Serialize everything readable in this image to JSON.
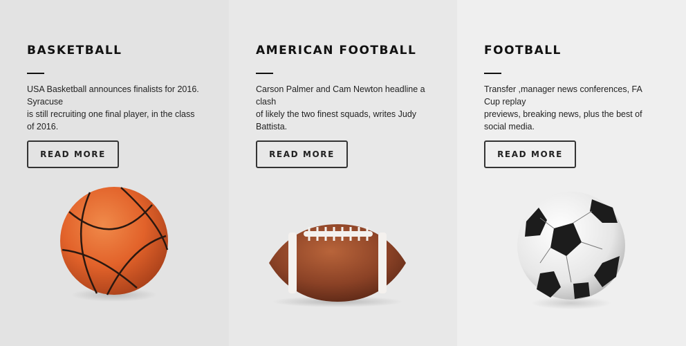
{
  "cards": [
    {
      "title": "BASKETBALL",
      "desc_lines": [
        "USA Basketball announces finalists for 2016. Syracuse",
        "is still recruiting one final player, in the class of 2016."
      ],
      "button": "READ MORE",
      "image_icon": "basketball-icon"
    },
    {
      "title": "AMERICAN FOOTBALL",
      "desc_lines": [
        "Carson Palmer and Cam Newton headline a clash",
        "of likely the two finest squads, writes Judy Battista."
      ],
      "button": "READ MORE",
      "image_icon": "american-football-icon"
    },
    {
      "title": "FOOTBALL",
      "desc_lines": [
        "Transfer ,manager news conferences, FA Cup replay",
        "previews, breaking news, plus the best of social media."
      ],
      "button": "READ MORE",
      "image_icon": "soccer-ball-icon"
    }
  ],
  "colors": {
    "panel_1": "#e3e3e3",
    "panel_2": "#e8e8e8",
    "panel_3": "#efefef",
    "text": "#111111",
    "basketball": "#e2622a",
    "football_leather": "#8b4226"
  }
}
